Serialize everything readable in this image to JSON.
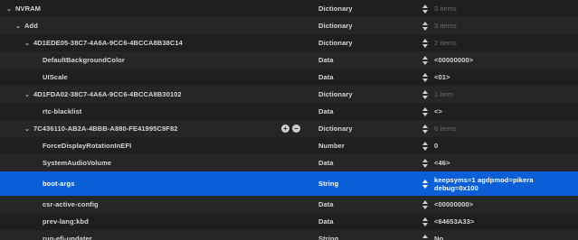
{
  "rows": [
    {
      "key": "NVRAM",
      "type": "Dictionary",
      "value": "3 items",
      "expanded": true,
      "dim": true
    },
    {
      "key": "Add",
      "type": "Dictionary",
      "value": "3 items",
      "expanded": true,
      "dim": true
    },
    {
      "key": "4D1EDE05-38C7-4A6A-9CC6-4BCCA8B38C14",
      "type": "Dictionary",
      "value": "2 items",
      "expanded": true,
      "dim": true
    },
    {
      "key": "DefaultBackgroundColor",
      "type": "Data",
      "value": "<00000000>"
    },
    {
      "key": "UIScale",
      "type": "Data",
      "value": "<01>"
    },
    {
      "key": "4D1FDA02-38C7-4A6A-9CC6-4BCCA8B30102",
      "type": "Dictionary",
      "value": "1 item",
      "expanded": true,
      "dim": true
    },
    {
      "key": "rtc-blacklist",
      "type": "Data",
      "value": "<>"
    },
    {
      "key": "7C436110-AB2A-4BBB-A880-FE41995C9F82",
      "type": "Dictionary",
      "value": "6 items",
      "expanded": true,
      "dim": true,
      "controls": true
    },
    {
      "key": "ForceDisplayRotationInEFI",
      "type": "Number",
      "value": "0"
    },
    {
      "key": "SystemAudioVolume",
      "type": "Data",
      "value": "<46>"
    },
    {
      "key": "boot-args",
      "type": "String",
      "value": "keepsyms=1 agdpmod=pikera debug=0x100",
      "selected": true
    },
    {
      "key": "csr-active-config",
      "type": "Data",
      "value": "<00000000>"
    },
    {
      "key": "prev-lang:kbd",
      "type": "Data",
      "value": "<64653A33>"
    },
    {
      "key": "run-efi-updater",
      "type": "String",
      "value": "No"
    }
  ],
  "icons": {
    "disclosure": "chevron-down-icon",
    "stepper": "stepper-icon",
    "add": "plus-circle-icon",
    "remove": "minus-circle-icon"
  },
  "glyphs": {
    "disclosure": "⌄",
    "add": "+",
    "remove": "−"
  },
  "colors": {
    "background": "#1f1f1f",
    "alt_row": "#262626",
    "selection": "#0b5fd6",
    "text": "#d6d6d6",
    "dim_text": "#6b6b6b"
  }
}
